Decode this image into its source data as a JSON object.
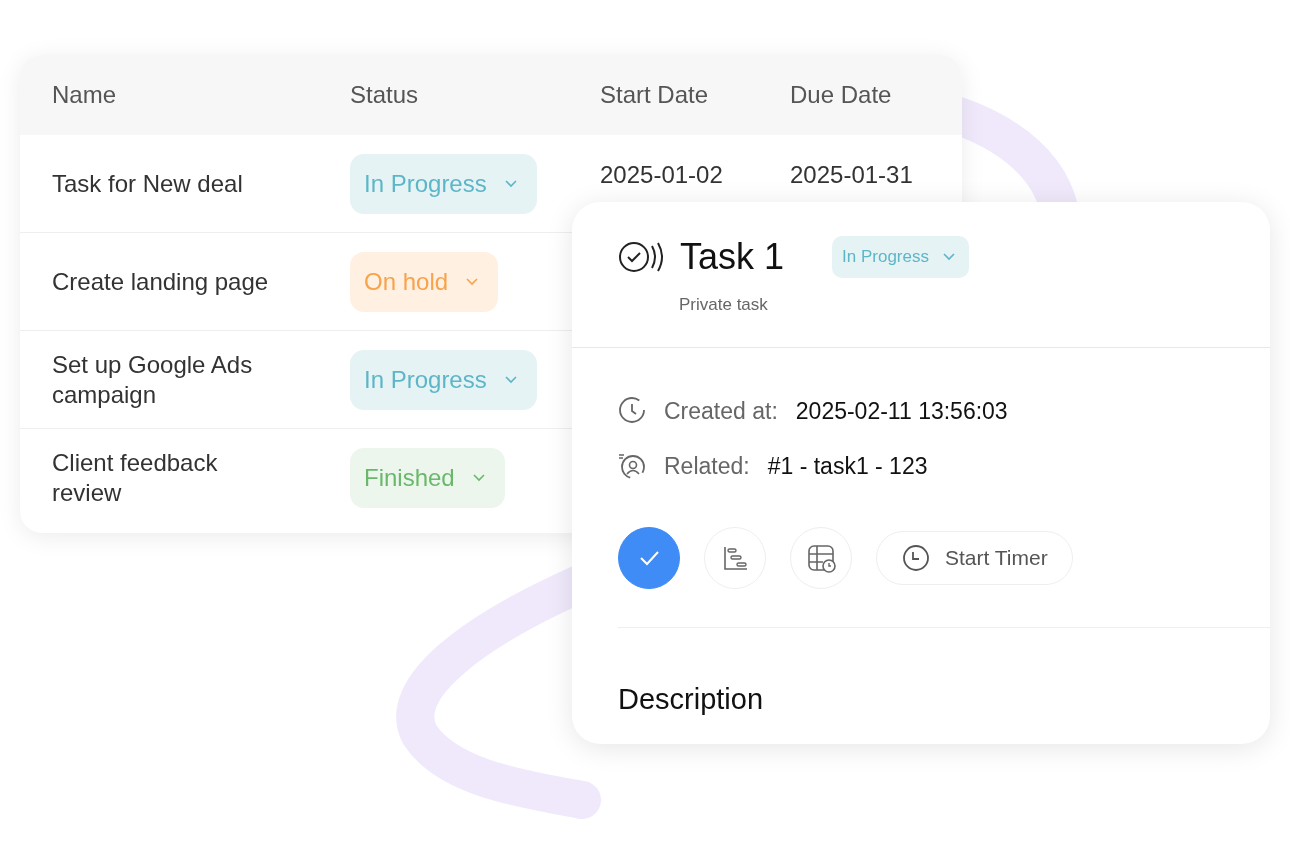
{
  "table": {
    "columns": [
      "Name",
      "Status",
      "Start Date",
      "Due Date"
    ],
    "rows": [
      {
        "name": "Task for New deal",
        "status": {
          "label": "In Progress",
          "kind": "in_progress"
        },
        "start_date": "2025-01-02",
        "due_date": "2025-01-31"
      },
      {
        "name": "Create landing page",
        "status": {
          "label": "On hold",
          "kind": "on_hold"
        }
      },
      {
        "name": "Set up Google Ads campaign",
        "status": {
          "label": "In Progress",
          "kind": "in_progress"
        }
      },
      {
        "name": "Client feedback review",
        "status": {
          "label": "Finished",
          "kind": "finished"
        }
      }
    ]
  },
  "detail": {
    "title": "Task 1",
    "subtitle": "Private task",
    "status": {
      "label": "In Progress",
      "kind": "in_progress"
    },
    "fields": [
      {
        "kind": "created",
        "label": "Created at:",
        "value": "2025-02-11 13:56:03"
      },
      {
        "kind": "related",
        "label": "Related:",
        "value": "#1 - task1 - 123"
      }
    ],
    "actions": [
      {
        "kind": "complete",
        "on": true
      },
      {
        "kind": "gantt",
        "on": false
      },
      {
        "kind": "schedule",
        "on": false
      },
      {
        "kind": "timer",
        "label": "Start Timer",
        "on": false
      }
    ],
    "section_title": "Description"
  }
}
